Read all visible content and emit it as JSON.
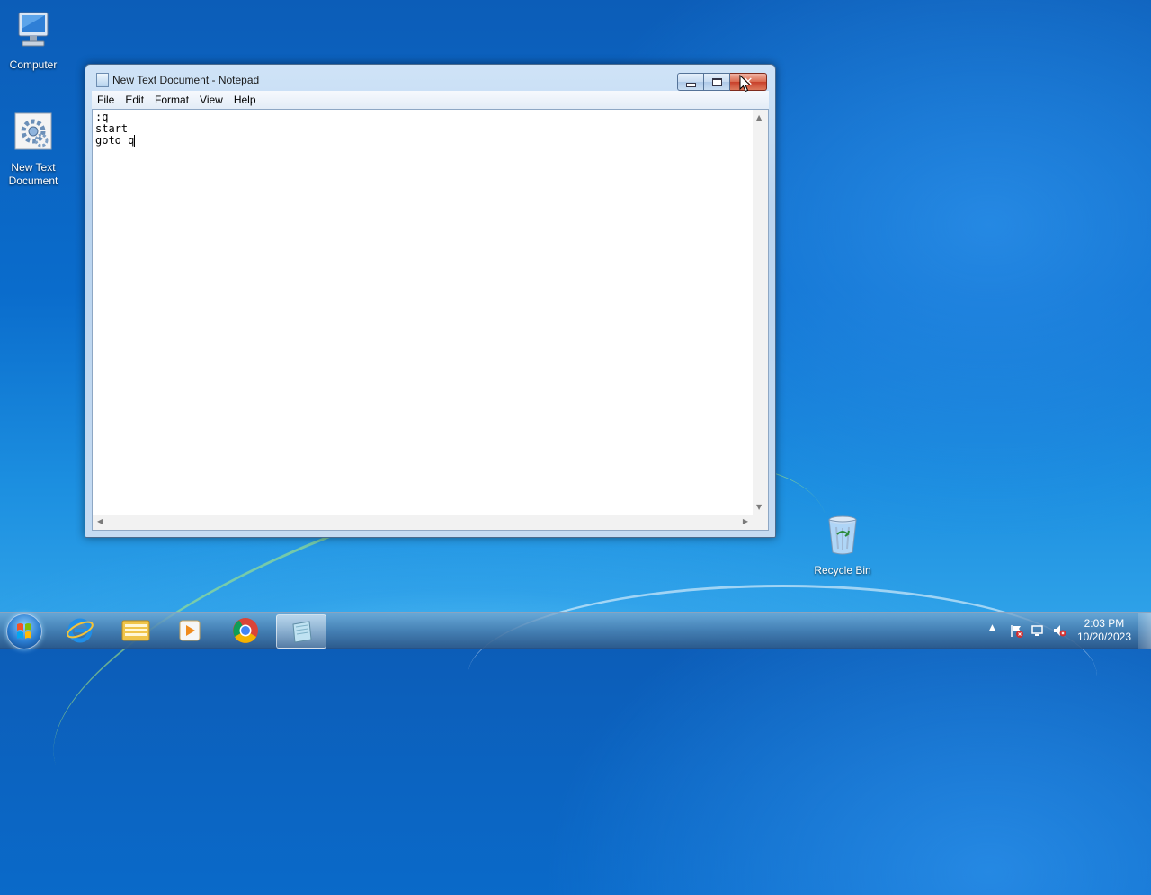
{
  "desktop": {
    "icons": [
      {
        "label": "Computer"
      },
      {
        "label": "New Text Document"
      },
      {
        "label": "Recycle Bin"
      }
    ]
  },
  "window": {
    "title": "New Text Document - Notepad",
    "menu": [
      "File",
      "Edit",
      "Format",
      "View",
      "Help"
    ],
    "content_lines": [
      ":q",
      "start",
      "goto q"
    ]
  },
  "taskbar": {
    "apps": [
      "start-button",
      "internet-explorer-icon",
      "windows-explorer-icon",
      "media-player-icon",
      "chrome-icon",
      "notepad-icon"
    ],
    "clock": {
      "time": "2:03 PM",
      "date": "10/20/2023"
    }
  },
  "colors": {
    "close_button": "#c8402a",
    "desktop_blue": "#0a6ccc"
  }
}
